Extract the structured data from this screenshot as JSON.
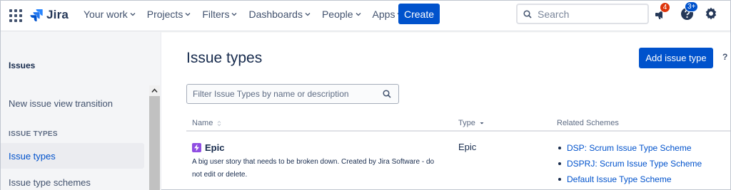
{
  "topnav": {
    "logo_text": "Jira",
    "items": [
      {
        "label": "Your work"
      },
      {
        "label": "Projects"
      },
      {
        "label": "Filters"
      },
      {
        "label": "Dashboards"
      },
      {
        "label": "People"
      },
      {
        "label": "Apps"
      }
    ],
    "create_label": "Create",
    "search_placeholder": "Search",
    "notifications_count": "4",
    "help_count": "3+"
  },
  "sidebar": {
    "heading": "Issues",
    "link_transition": "New issue view transition",
    "section_label": "ISSUE TYPES",
    "active_item": "Issue types",
    "link_schemes": "Issue type schemes"
  },
  "main": {
    "title": "Issue types",
    "add_button": "Add issue type",
    "help": "?",
    "filter_placeholder": "Filter Issue Types by name or description",
    "columns": {
      "name": "Name",
      "type": "Type",
      "schemes": "Related Schemes"
    },
    "rows": [
      {
        "name": "Epic",
        "description": "A big user story that needs to be broken down. Created by Jira Software - do not edit or delete.",
        "type": "Epic",
        "schemes": [
          "DSP: Scrum Issue Type Scheme",
          "DSPRJ: Scrum Issue Type Scheme",
          "Default Issue Type Scheme"
        ]
      }
    ]
  },
  "colors": {
    "primary": "#0052cc",
    "epic": "#904ee2",
    "badge_red": "#de350b",
    "badge_blue": "#0052cc"
  }
}
